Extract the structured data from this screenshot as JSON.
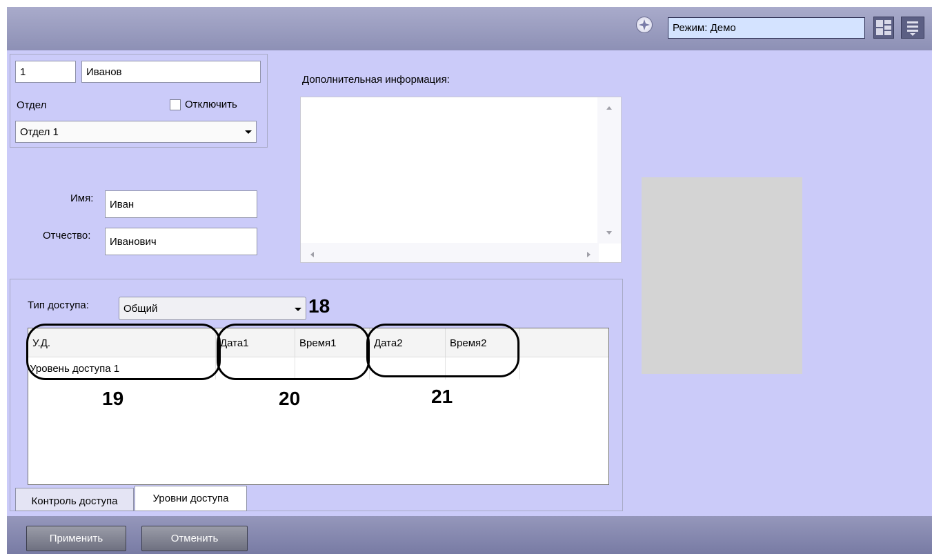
{
  "topbar": {
    "mode_text": "Режим: Демо"
  },
  "person": {
    "id": "1",
    "last_name": "Иванов",
    "dept_label": "Отдел",
    "disable_label": "Отключить",
    "dept_value": "Отдел 1",
    "first_name_label": "Имя:",
    "first_name": "Иван",
    "patronymic_label": "Отчество:",
    "patronymic": "Иванович"
  },
  "extra_info": {
    "label": "Дополнительная информация:",
    "value": ""
  },
  "access": {
    "type_label": "Тип доступа:",
    "type_value": "Общий",
    "columns": [
      "У.Д.",
      "Дата1",
      "Время1",
      "Дата2",
      "Время2"
    ],
    "rows": [
      [
        "Уровень доступа 1",
        "",
        "",
        "",
        ""
      ]
    ]
  },
  "callouts": {
    "c18": "18",
    "c19": "19",
    "c20": "20",
    "c21": "21"
  },
  "tabs": [
    "Контроль доступа",
    "Уровни доступа"
  ],
  "buttons": {
    "apply": "Применить",
    "cancel": "Отменить"
  },
  "colors": {
    "content_bg": "#cbcbf9",
    "topbar": "#9c9ec2",
    "photo_placeholder": "#d4d4d4"
  },
  "icons": [
    "mode-icon",
    "layout-grid-icon",
    "menu-icon",
    "dropdown-arrow-icon"
  ]
}
